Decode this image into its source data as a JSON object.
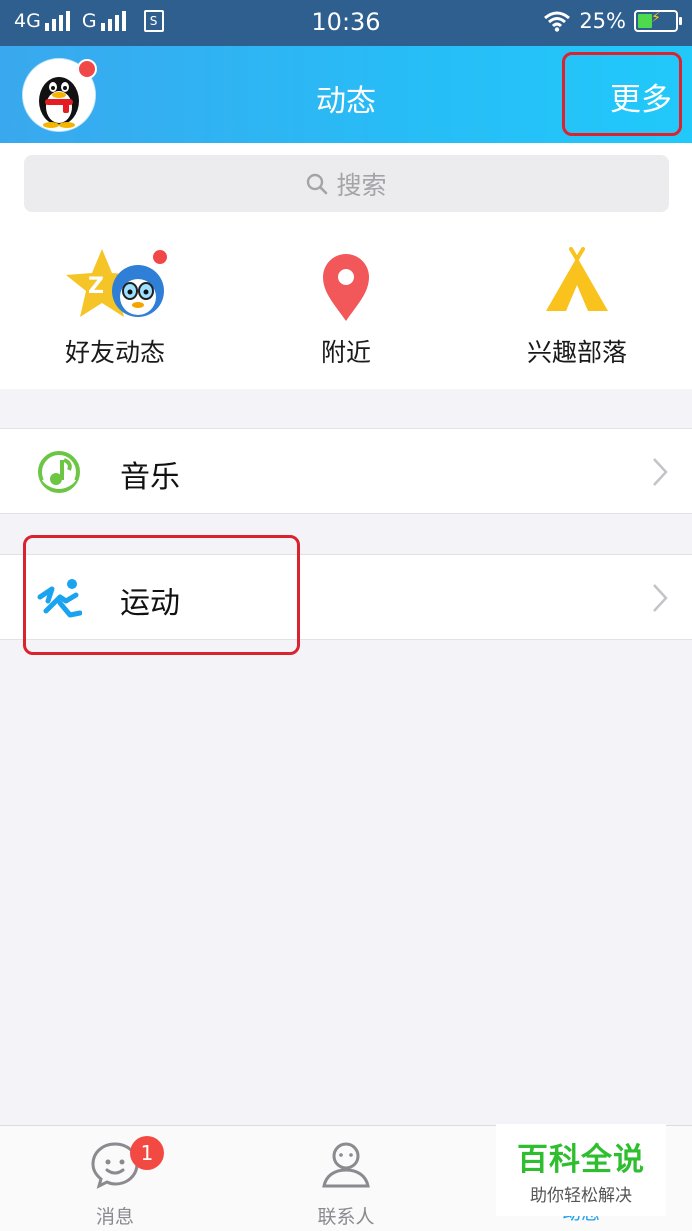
{
  "status_bar": {
    "network_1": "4G",
    "network_2": "G",
    "time": "10:36",
    "battery_percent": "25%",
    "battery_level": 0.25
  },
  "header": {
    "title": "动态",
    "more_label": "更多"
  },
  "search": {
    "placeholder": "搜索"
  },
  "quick_entries": [
    {
      "label": "好友动态",
      "icon": "qzone-star-icon"
    },
    {
      "label": "附近",
      "icon": "location-pin-icon"
    },
    {
      "label": "兴趣部落",
      "icon": "tent-icon"
    }
  ],
  "list": [
    {
      "label": "音乐",
      "icon": "music-note-icon"
    },
    {
      "label": "运动",
      "icon": "running-icon"
    }
  ],
  "tabbar": {
    "tabs": [
      {
        "label": "消息",
        "icon": "chat-bubble-icon",
        "badge": "1"
      },
      {
        "label": "联系人",
        "icon": "contacts-icon"
      },
      {
        "label": "动态",
        "icon": "star-icon"
      }
    ]
  },
  "watermark": {
    "title": "百科全说",
    "subtitle": "助你轻松解决"
  },
  "colors": {
    "header_gradient_start": "#3aa8ee",
    "header_gradient_end": "#21c9fb",
    "highlight_outline": "#d9232e",
    "badge": "#f24a42",
    "active_tab": "#1fa1f0"
  }
}
